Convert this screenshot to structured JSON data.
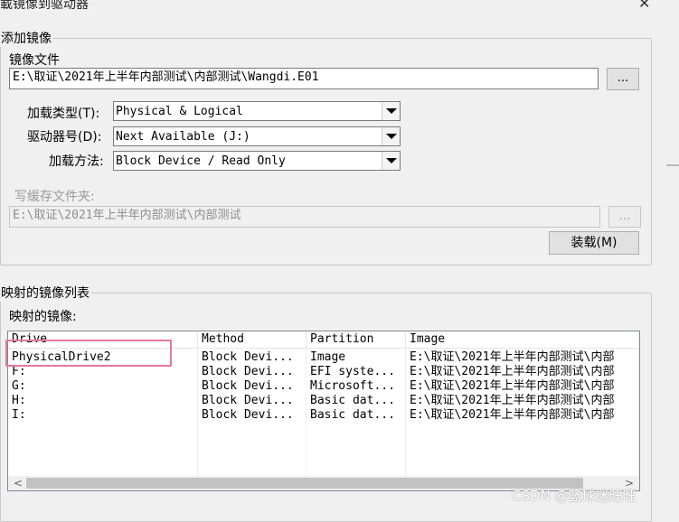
{
  "window": {
    "title": "載镜像到驱动器",
    "close_glyph": "✕"
  },
  "add_image": {
    "group_label": "添加镜像",
    "image_file_label": "镜像文件",
    "image_file_value": "E:\\取证\\2021年上半年内部测试\\内部测试\\Wangdi.E01",
    "browse_label": "...",
    "mount_type_label": "加载类型(T):",
    "mount_type_value": "Physical & Logical",
    "drive_letter_label": "驱动器号(D):",
    "drive_letter_value": "Next Available (J:)",
    "mount_method_label": "加载方法:",
    "mount_method_value": "Block Device / Read Only",
    "cache_folder_label": "写缓存文件夹:",
    "cache_folder_value": "E:\\取证\\2021年上半年内部测试\\内部测试",
    "cache_browse_label": "...",
    "mount_button": "装载(M)"
  },
  "mapped": {
    "group_label": "映射的镜像列表",
    "list_label": "映射的镜像:",
    "columns": [
      "Drive",
      "Method",
      "Partition",
      "Image"
    ],
    "rows": [
      [
        "PhysicalDrive2",
        "Block Devi...",
        "Image",
        "E:\\取证\\2021年上半年内部测试\\内部"
      ],
      [
        "F:",
        "Block Devi...",
        "EFI syste...",
        "E:\\取证\\2021年上半年内部测试\\内部"
      ],
      [
        "G:",
        "Block Devi...",
        "Microsoft...",
        "E:\\取证\\2021年上半年内部测试\\内部"
      ],
      [
        "H:",
        "Block Devi...",
        "Basic dat...",
        "E:\\取证\\2021年上半年内部测试\\内部"
      ],
      [
        "I:",
        "Block Devi...",
        "Basic dat...",
        "E:\\取证\\2021年上半年内部测试\\内部"
      ]
    ],
    "scroll_left": "<",
    "scroll_right": ">"
  },
  "watermark": "CSDN @篮球迷旺旺",
  "colors": {
    "highlight": "#e8779e",
    "accent_border": "#7a7a7a"
  }
}
